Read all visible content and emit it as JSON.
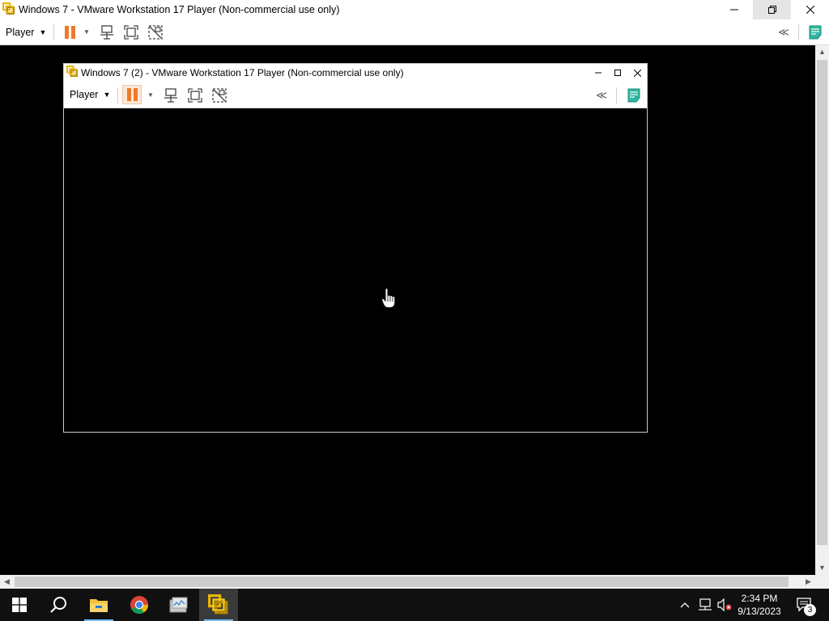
{
  "outer_window": {
    "title": "Windows 7 - VMware Workstation 17 Player (Non-commercial use only)",
    "controls": {
      "minimize": "—",
      "restore": "❐",
      "close": "✕"
    }
  },
  "outer_toolbar": {
    "player_menu": "Player",
    "icons": [
      "pause-icon",
      "send-ctrl-alt-del-icon",
      "fit-guest-icon",
      "unity-icon",
      "collapse-toolbar-icon",
      "message-log-icon"
    ]
  },
  "inner_window": {
    "title": "Windows 7 (2) - VMware Workstation 17 Player (Non-commercial use only)",
    "controls": {
      "minimize": "—",
      "maximize": "☐",
      "close": "✕"
    }
  },
  "inner_toolbar": {
    "player_menu": "Player"
  },
  "scrollbars": {
    "up": "▲",
    "down": "▼",
    "left": "◀",
    "right": "▶"
  },
  "taskbar": {
    "apps": [
      "start-button",
      "search",
      "file-explorer",
      "google-chrome",
      "server-manager",
      "vmware-player"
    ],
    "tray": {
      "time": "2:34 PM",
      "date": "9/13/2023",
      "notification_count": "3"
    }
  },
  "colors": {
    "accent_orange": "#f07a2a",
    "vmware_yellow": "#e8b400",
    "message_teal": "#2fb5a0",
    "taskbar": "#101010"
  }
}
